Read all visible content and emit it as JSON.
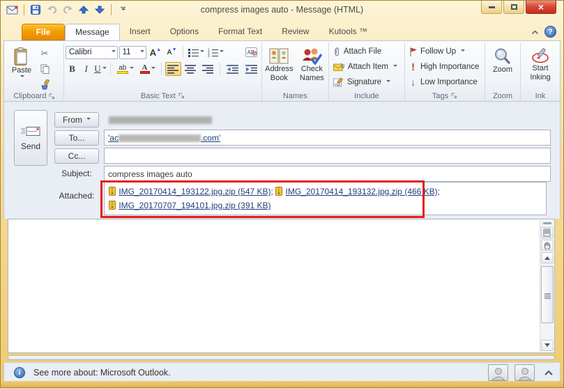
{
  "window": {
    "title": "compress images auto  - Message (HTML)"
  },
  "tabs": {
    "items": [
      "File",
      "Message",
      "Insert",
      "Options",
      "Format Text",
      "Review",
      "Kutools ™"
    ],
    "active": "Message"
  },
  "ribbon": {
    "clipboard": {
      "group_label": "Clipboard",
      "paste_label": "Paste"
    },
    "basic_text": {
      "group_label": "Basic Text",
      "font_name": "Calibri",
      "font_size": "11",
      "bold": "B",
      "italic": "I",
      "underline": "U"
    },
    "names": {
      "group_label": "Names",
      "address_book_label": "Address Book",
      "check_names_label": "Check Names"
    },
    "include": {
      "group_label": "Include",
      "attach_file_label": "Attach File",
      "attach_item_label": "Attach Item",
      "signature_label": "Signature"
    },
    "tags": {
      "group_label": "Tags",
      "follow_up_label": "Follow Up",
      "high_importance_label": "High Importance",
      "low_importance_label": "Low Importance",
      "high_importance_glyph": "!",
      "low_importance_glyph": "↓"
    },
    "zoom": {
      "group_label": "Zoom",
      "zoom_label": "Zoom"
    },
    "ink": {
      "group_label": "Ink",
      "start_inking_label": "Start Inking"
    }
  },
  "message": {
    "send_label": "Send",
    "from_label": "From",
    "to_label": "To...",
    "cc_label": "Cc...",
    "subject_label": "Subject:",
    "subject_value": "compress images auto",
    "attached_label": "Attached:",
    "to_value_visible_prefix": "'ac",
    "to_value_visible_suffix": ".com'",
    "attachments": [
      {
        "label": "IMG_20170414_193122.jpg.zip (547 KB)",
        "separator": "; "
      },
      {
        "label": "IMG_20170414_193132.jpg.zip (466 KB)",
        "separator": ";"
      },
      {
        "label": "IMG_20170707_194101.jpg.zip (391 KB)",
        "separator": ""
      }
    ]
  },
  "status_bar": {
    "info_text": "See more about: Microsoft Outlook."
  },
  "icons": {
    "program": "envelope-with-red-dot",
    "save": "blue-floppy-disk",
    "undo": "curved-arrow-left-gray",
    "redo": "curved-arrow-right-gray",
    "previous_item": "blue-arrow-up",
    "next_item": "blue-arrow-down",
    "paste": "clipboard-with-page",
    "cut": "scissors",
    "copy": "two-pages",
    "format_painter": "paintbrush",
    "attach_file": "paperclip",
    "attach_item": "envelope-with-clip",
    "signature": "pen-on-page",
    "follow_up": "red-flag",
    "zoom": "magnifier",
    "start_inking": "red-pen-swirl",
    "send": "envelope-speeding",
    "attachment_file": "yellow-zip-file",
    "info": "blue-info-circle",
    "contact": "person-silhouette"
  },
  "colors": {
    "annotation_red": "#e31c1c",
    "file_tab_orange": "#f59d00",
    "close_button_red": "#c22d1c",
    "selected_tool_gold": "#fcd575",
    "link_blue": "#1f3f77",
    "help_blue": "#2f62b5"
  }
}
